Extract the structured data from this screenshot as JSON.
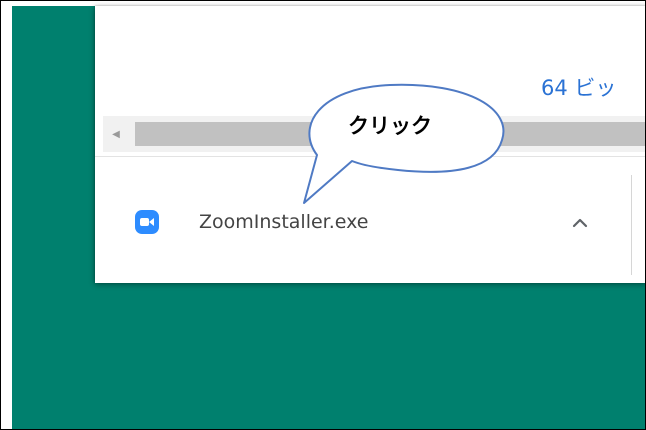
{
  "window": {
    "partial_heading": "64 ビッ"
  },
  "download_shelf": {
    "file_name": "ZoomInstaller.exe",
    "file_icon": "zoom-app-icon",
    "expand_icon": "chevron-up-icon"
  },
  "annotation": {
    "callout_text": "クリック"
  },
  "colors": {
    "desktop_background": "#00806e",
    "link_blue": "#2a72d4",
    "zoom_blue": "#2d8cff",
    "callout_border": "#4f7ac4"
  }
}
